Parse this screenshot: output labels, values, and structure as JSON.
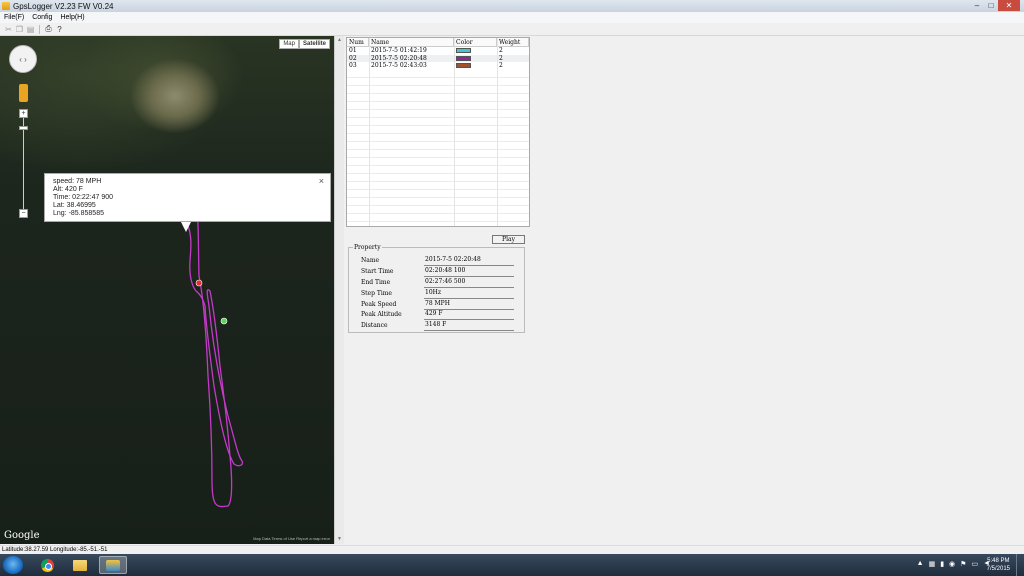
{
  "window": {
    "title": "GpsLogger  V2.23   FW  V0.24",
    "controls": {
      "minimize": "–",
      "maximize": "□",
      "close": "✕"
    }
  },
  "menu": [
    "File(F)",
    "Config",
    "Help(H)"
  ],
  "toolbar": [
    "cut",
    "copy",
    "paste",
    "print",
    "help"
  ],
  "map": {
    "type_buttons": [
      "Map",
      "Satellite"
    ],
    "zoom_in": "+",
    "zoom_out": "−",
    "logo": "Google",
    "footer": "Map Data   Terms of Use   Report a map error",
    "track_color": "#c43ac8",
    "info": {
      "close": "×",
      "lines": [
        "speed: 78 MPH",
        "Alt: 420 F",
        "Time: 02:22:47 900",
        "Lat: 38.46995",
        "Lng: -85.858585"
      ]
    }
  },
  "statusbar": "Latitude:38.27.59 Longitude:-85.-51.-51",
  "tracks": {
    "headers": [
      "Num",
      "Name",
      "Color",
      "Weight"
    ],
    "rows": [
      {
        "num": "01",
        "name": "2015-7-5 01:42:19",
        "color": "#3ec9c9",
        "weight": "2"
      },
      {
        "num": "02",
        "name": "2015-7-5 02:20:48",
        "color": "#8a2a9a",
        "weight": "2"
      },
      {
        "num": "03",
        "name": "2015-7-5 02:43:03",
        "color": "#a0522d",
        "weight": "2"
      }
    ],
    "selected_index": 1
  },
  "play_label": "Play",
  "property": {
    "legend": "Property",
    "rows": [
      {
        "key": "Name",
        "value": "2015-7-5 02:20:48"
      },
      {
        "key": "Start Time",
        "value": "02:20:48 100"
      },
      {
        "key": "End Time",
        "value": "02:27:46 500"
      },
      {
        "key": "Step Time",
        "value": "10Hz"
      },
      {
        "key": "Peak Speed",
        "value": "78 MPH"
      },
      {
        "key": "Peak Altitude",
        "value": "429 F"
      },
      {
        "key": "Distance",
        "value": "3148 F"
      }
    ]
  },
  "taskbar": {
    "apps": [
      "chrome-icon",
      "file-explorer-icon",
      "gpslogger-icon"
    ],
    "clock_time": "5:48 PM",
    "clock_date": "7/5/2015"
  }
}
